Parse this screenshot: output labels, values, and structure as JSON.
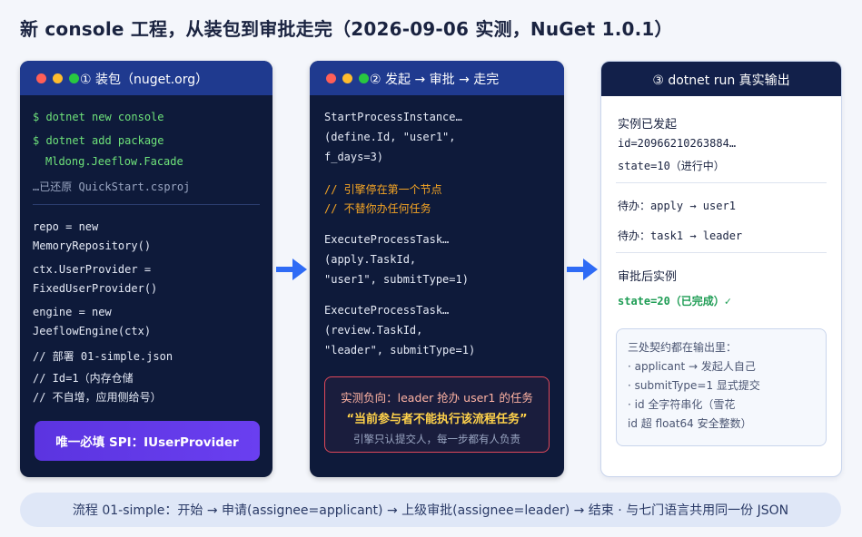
{
  "page": {
    "title": "新 console 工程，从装包到审批走完（2026-09-06 实测，NuGet 1.0.1）"
  },
  "panel1": {
    "title": "① 装包（nuget.org）",
    "cmd1": "$ dotnet new console",
    "cmd2": "$ dotnet add package",
    "cmd2b": "Mldong.Jeeflow.Facade",
    "restored": "…已还原 QuickStart.csproj",
    "code": [
      "repo = new",
      "MemoryRepository()",
      "ctx.UserProvider =",
      "FixedUserProvider()",
      "engine = new",
      "JeeflowEngine(ctx)",
      "// 部署 01-simple.json",
      "// Id=1（内存仓储",
      "// 不自增，应用侧给号）"
    ],
    "spi_label": "唯一必填 SPI：IUserProvider"
  },
  "panel2": {
    "title": "② 发起 → 审批 → 走完",
    "block1": [
      "StartProcessInstance…",
      "(define.Id, \"user1\",",
      "f_days=3)"
    ],
    "comment": [
      "// 引擎停在第一个节点",
      "// 不替你办任何任务"
    ],
    "block2": [
      "ExecuteProcessTask…",
      "(apply.TaskId,",
      "\"user1\", submitType=1)"
    ],
    "block3": [
      "ExecuteProcessTask…",
      "(review.TaskId,",
      "\"leader\", submitType=1)"
    ],
    "warn": {
      "line1": "实测负向：leader 抢办 user1 的任务",
      "line2": "“当前参与者不能执行该流程任务”",
      "line3": "引擎只认提交人，每一步都有人负责"
    }
  },
  "panel3": {
    "title": "③ dotnet run 真实输出",
    "started_label": "实例已发起",
    "id_line": "id=20966210263884…",
    "state_line": "state=10（进行中）",
    "todo1": "待办：apply → user1",
    "todo2": "待办：task1 → leader",
    "after_label": "审批后实例",
    "final_state": "state=20（已完成）✓",
    "note": {
      "head": "三处契约都在输出里：",
      "items": [
        "· applicant → 发起人自己",
        "· submitType=1 显式提交",
        "· id 全字符串化（雪花",
        "id 超 float64 安全整数）"
      ]
    }
  },
  "footer": {
    "text": "流程 01-simple：开始 → 申请(assignee=applicant) → 上级审批(assignee=leader) → 结束 · 与七门语言共用同一份 JSON"
  },
  "colors": {
    "dark_card": "#0e1a3a",
    "card_header": "#1f3a8f",
    "accent_purple": "#5b34e0",
    "arrow_blue": "#2f6bf5",
    "command_green": "#6ee27a",
    "comment_orange": "#f5a524",
    "warn_red": "#e0485a",
    "success_green": "#1f9d55"
  },
  "icons": {
    "flow_arrow": "arrow-right-icon",
    "window_controls": "traffic-light-dots-icon"
  }
}
